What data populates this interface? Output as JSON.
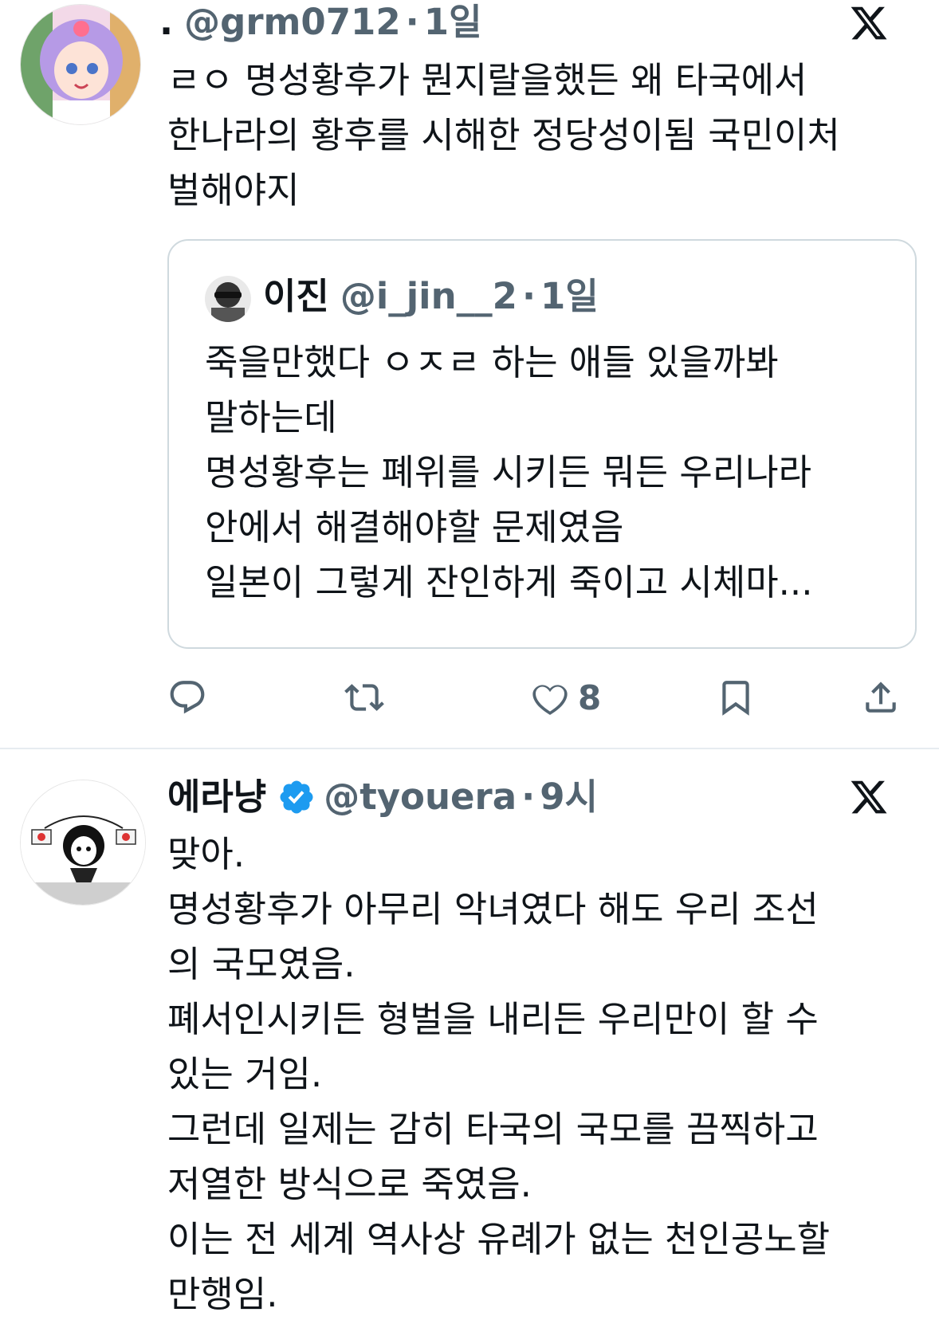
{
  "tweet1": {
    "name": ".",
    "handle": "@grm0712",
    "separator": "·",
    "time": "1일",
    "lines": [
      "ㄹㅇ 명성황후가 뭔지랄을했든 왜 타국에서",
      "한나라의 황후를 시해한 정당성이됨 국민이처",
      "벌해야지"
    ],
    "quote": {
      "name": "이진",
      "handle": "@i_jin__2",
      "separator": "·",
      "time": "1일",
      "lines": [
        "죽을만했다 ㅇㅈㄹ 하는 애들 있을까봐",
        "말하는데",
        "명성황후는 폐위를 시키든 뭐든 우리나라",
        "안에서 해결해야할 문제였음",
        "일본이 그렇게 잔인하게 죽이고 시체마..."
      ]
    },
    "actions": {
      "like_count": "8"
    }
  },
  "tweet2": {
    "name": "에라냥",
    "handle": "@tyouera",
    "separator": "·",
    "time": "9시",
    "lines": [
      "맞아.",
      "명성황후가 아무리 악녀였다 해도 우리 조선",
      "의 국모였음.",
      "폐서인시키든 형벌을 내리든 우리만이 할 수",
      "있는 거임.",
      "그런데 일제는 감히 타국의 국모를 끔찍하고",
      "저열한 방식으로 죽였음.",
      "이는 전 세계 역사상 유례가 없는 천인공노할",
      "만행임."
    ]
  },
  "colors": {
    "text": "#0f1419",
    "secondary": "#536471",
    "border": "#cfd9de",
    "verified": "#1d9bf0"
  }
}
